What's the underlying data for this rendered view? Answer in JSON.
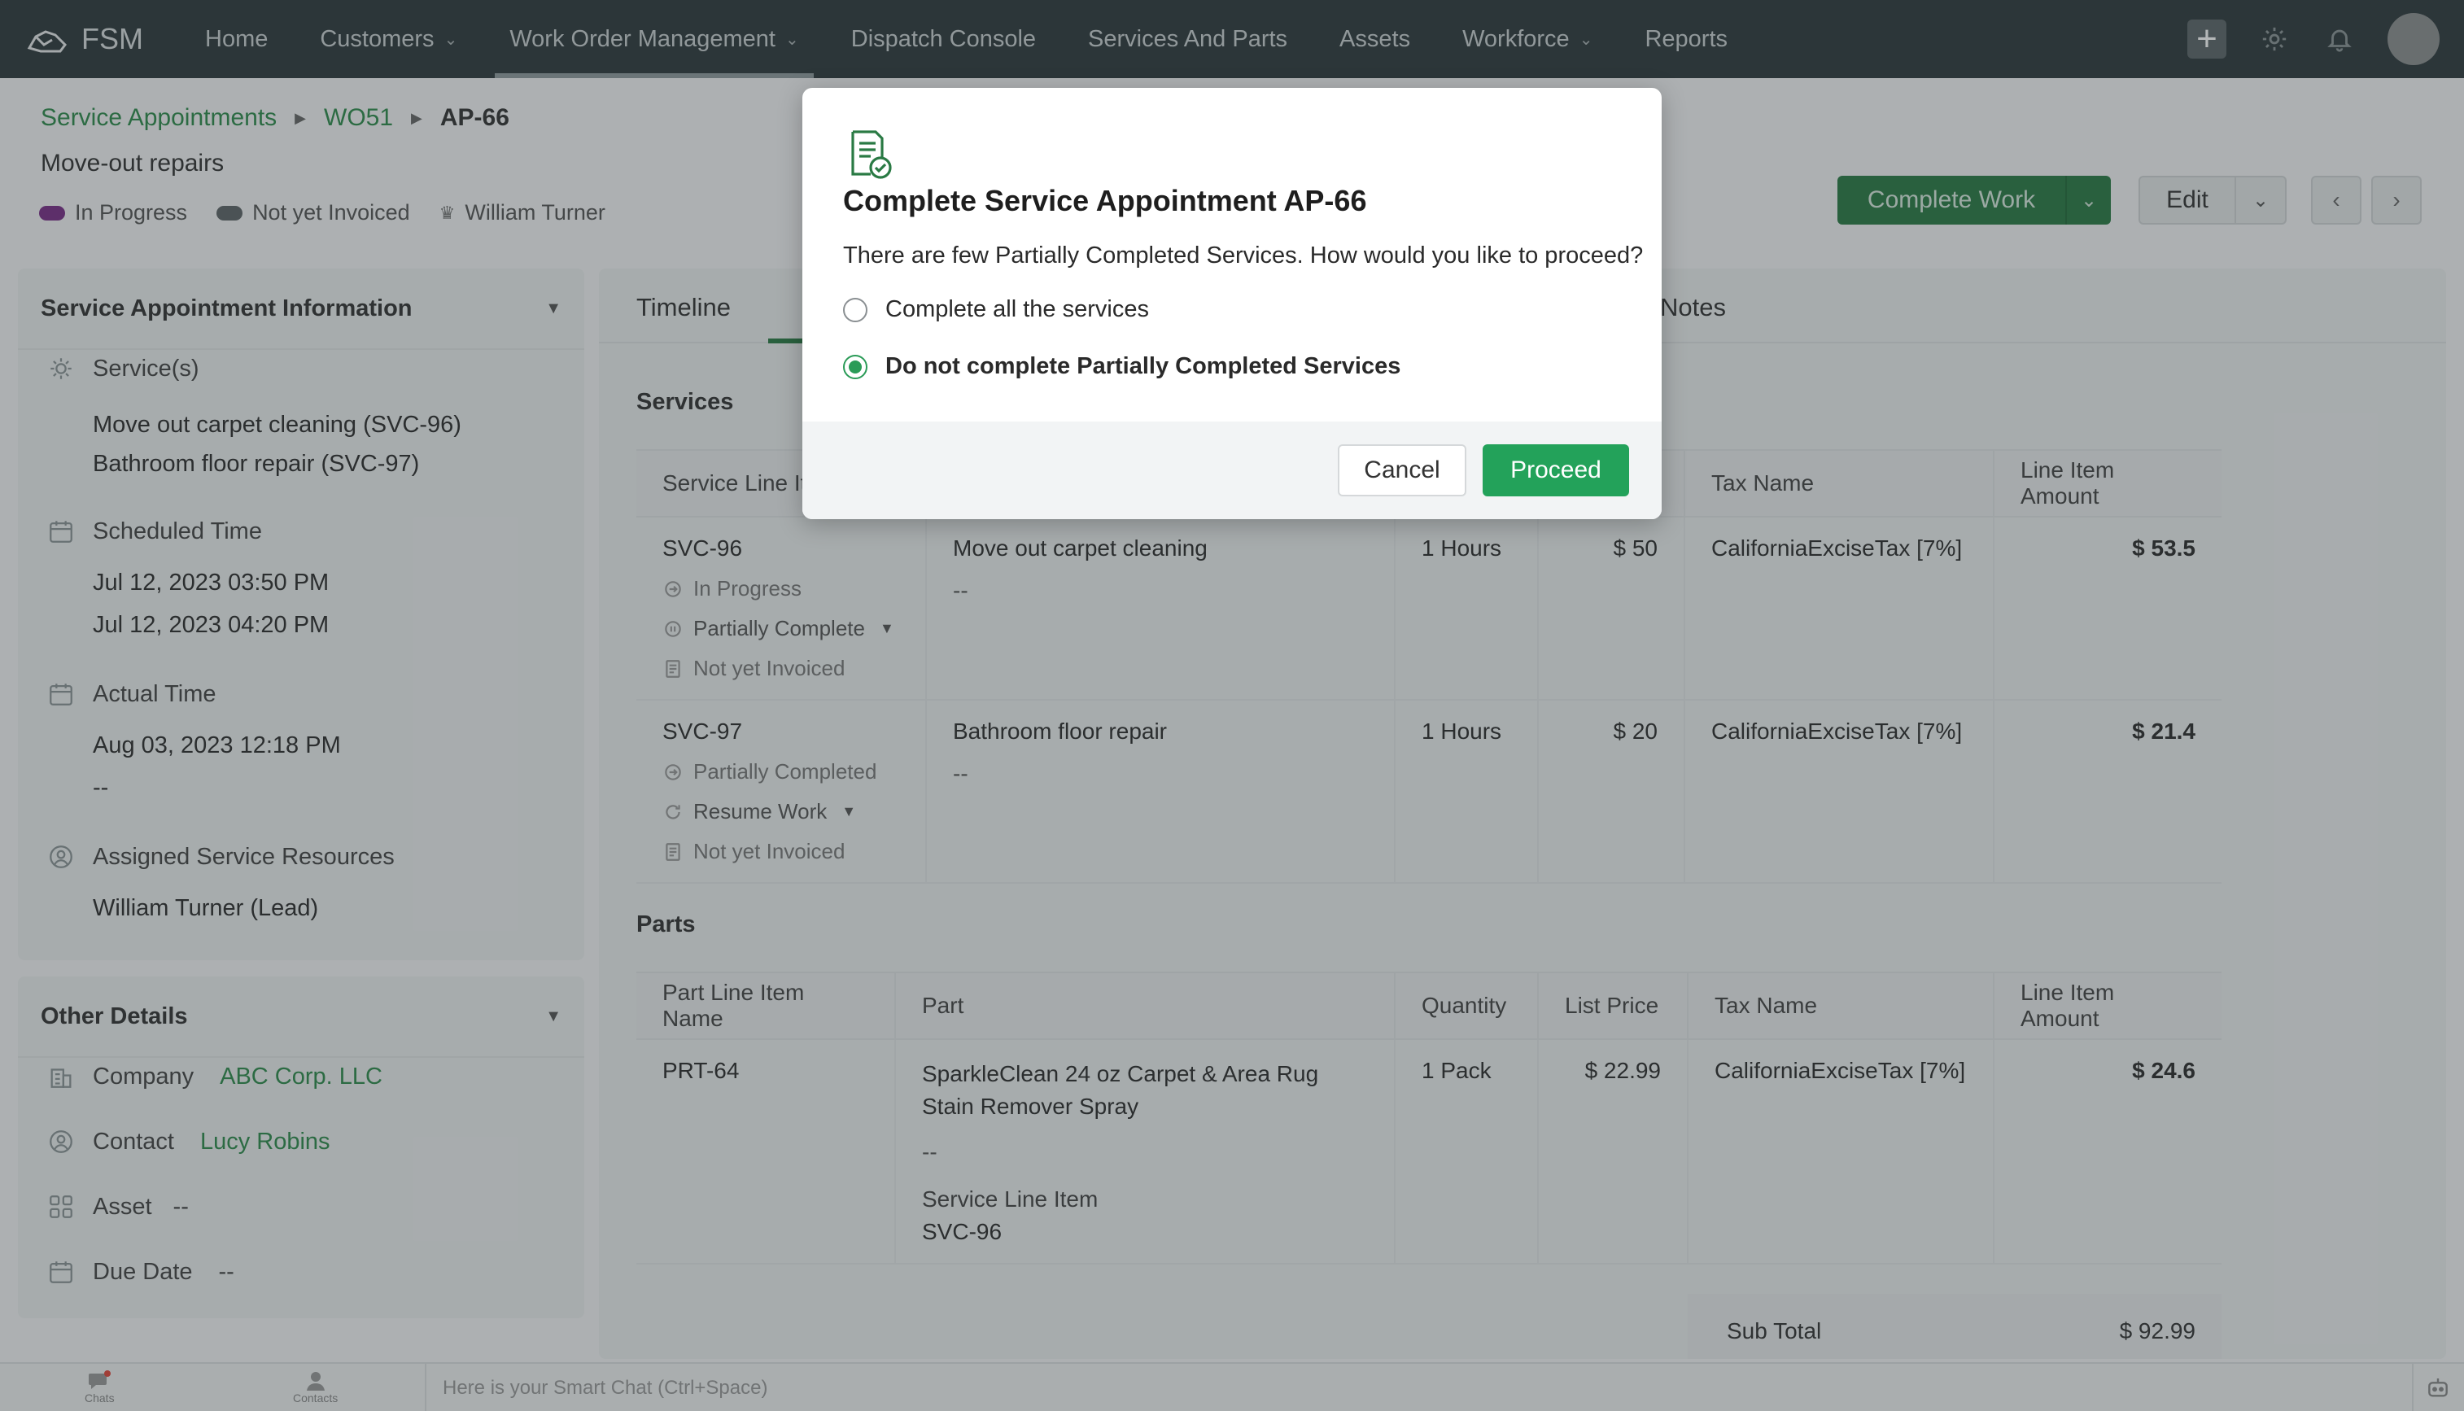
{
  "app": {
    "brand": "FSM"
  },
  "nav": {
    "items": [
      {
        "label": "Home",
        "has_dropdown": false
      },
      {
        "label": "Customers",
        "has_dropdown": true
      },
      {
        "label": "Work Order Management",
        "has_dropdown": true,
        "active": true
      },
      {
        "label": "Dispatch Console",
        "has_dropdown": false
      },
      {
        "label": "Services And Parts",
        "has_dropdown": false
      },
      {
        "label": "Assets",
        "has_dropdown": false
      },
      {
        "label": "Workforce",
        "has_dropdown": true
      },
      {
        "label": "Reports",
        "has_dropdown": false
      }
    ]
  },
  "header": {
    "breadcrumb": [
      "Service Appointments",
      "WO51",
      "AP-66"
    ],
    "subtitle": "Move-out repairs",
    "tags": [
      {
        "label": "In Progress",
        "color": "#7a2f87"
      },
      {
        "label": "Not yet Invoiced",
        "color": "#5f6567"
      },
      {
        "label": "William Turner",
        "icon": "crown-icon"
      }
    ],
    "actions": {
      "complete": "Complete Work",
      "edit": "Edit"
    }
  },
  "sidebar": {
    "info_title": "Service Appointment Information",
    "services_label": "Service(s)",
    "services": [
      "Move out carpet cleaning (SVC-96)",
      "Bathroom floor repair (SVC-97)"
    ],
    "scheduled_label": "Scheduled Time",
    "scheduled": [
      "Jul 12, 2023 03:50 PM",
      "Jul 12, 2023 04:20 PM"
    ],
    "actual_label": "Actual Time",
    "actual": [
      "Aug 03, 2023 12:18 PM",
      "--"
    ],
    "resources_label": "Assigned Service Resources",
    "resources": "William Turner (Lead)",
    "other_title": "Other Details",
    "company_label": "Company",
    "company": "ABC Corp. LLC",
    "contact_label": "Contact",
    "contact": "Lucy Robins",
    "asset_label": "Asset",
    "asset": "--",
    "due_label": "Due Date",
    "due": "--"
  },
  "main": {
    "tabs": {
      "timeline": "Timeline",
      "notes": "Notes"
    },
    "services_title": "Services",
    "services_headers": [
      "Service Line It",
      "",
      "",
      "",
      "Tax Name",
      "Line Item Amount"
    ],
    "services_rows": [
      {
        "id": "SVC-96",
        "status": "In Progress",
        "completion": "Partially Complete",
        "invoice": "Not yet Invoiced",
        "name": "Move out carpet cleaning",
        "desc": "--",
        "qty": "1 Hours",
        "price": "$ 50",
        "tax": "CaliforniaExciseTax [7%]",
        "amount": "$ 53.5"
      },
      {
        "id": "SVC-97",
        "status": "Partially Completed",
        "completion": "Resume Work",
        "invoice": "Not yet Invoiced",
        "name": "Bathroom floor repair",
        "desc": "--",
        "qty": "1 Hours",
        "price": "$ 20",
        "tax": "CaliforniaExciseTax [7%]",
        "amount": "$ 21.4"
      }
    ],
    "parts_title": "Parts",
    "parts_headers": [
      "Part Line Item Name",
      "Part",
      "Quantity",
      "List Price",
      "Tax Name",
      "Line Item Amount"
    ],
    "parts_rows": [
      {
        "id": "PRT-64",
        "part": "SparkleClean 24 oz Carpet & Area Rug Stain Remover Spray",
        "desc": "--",
        "svc_label": "Service Line Item",
        "svc": "SVC-96",
        "qty": "1 Pack",
        "price": "$ 22.99",
        "tax": "CaliforniaExciseTax [7%]",
        "amount": "$ 24.6"
      }
    ],
    "subtotal_label": "Sub Total",
    "subtotal": "$ 92.99"
  },
  "modal": {
    "title": "Complete Service Appointment AP-66",
    "question": "There are few Partially Completed Services. How would you like to proceed?",
    "options": [
      {
        "label": "Complete all the services",
        "selected": false
      },
      {
        "label": "Do not complete Partially Completed Services",
        "selected": true
      }
    ],
    "cancel": "Cancel",
    "proceed": "Proceed"
  },
  "bottombar": {
    "chats": "Chats",
    "contacts": "Contacts",
    "smartchat_placeholder": "Here is your Smart Chat (Ctrl+Space)"
  }
}
